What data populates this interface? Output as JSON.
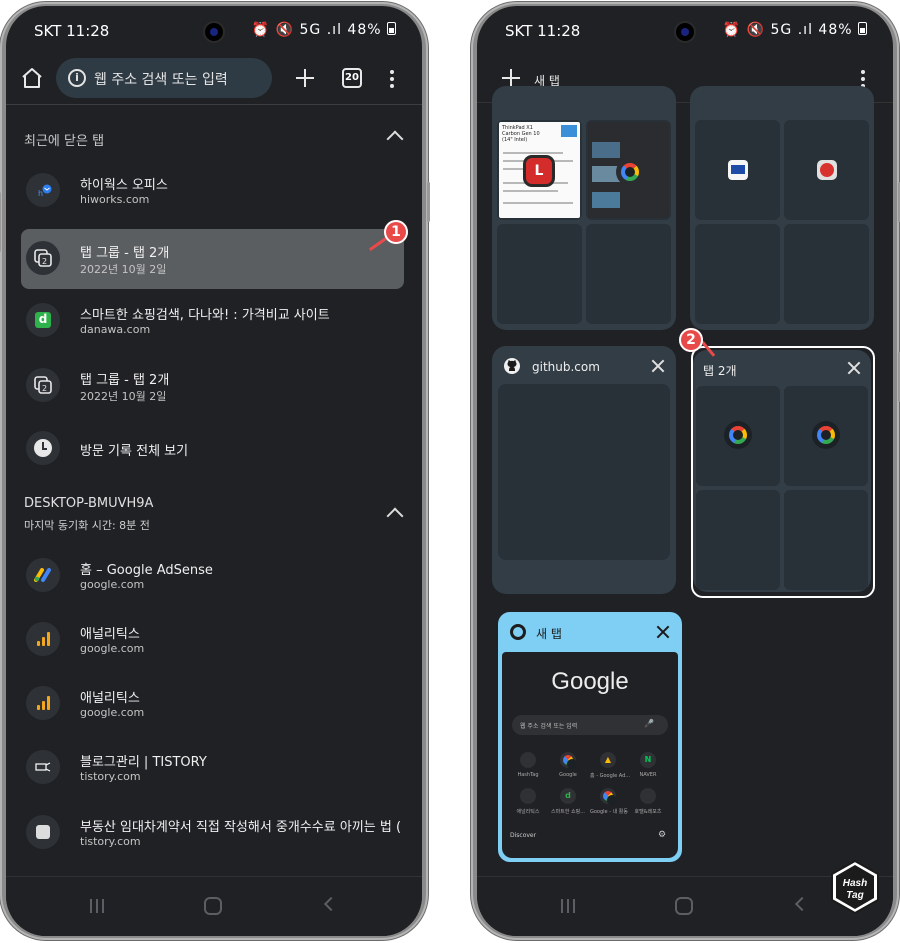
{
  "left": {
    "status": {
      "time": "SKT 11:28",
      "icons": "⏰ 🔇 5G .ıl",
      "battery": "48%"
    },
    "toolbar": {
      "search_placeholder": "웹 주소 검색 또는 입력",
      "tab_count": "20"
    },
    "recent_header": "최근에 닫은 탭",
    "recent": [
      {
        "title": "하이웍스 오피스",
        "sub": "hiworks.com",
        "icon": "hiworks-icon"
      },
      {
        "title": "탭 그룹 - 탭 2개",
        "sub": "2022년 10월 2일",
        "icon": "tab-group-icon"
      },
      {
        "title": "스마트한 쇼핑검색, 다나와! : 가격비교 사이트",
        "sub": "danawa.com",
        "icon": "danawa-icon",
        "favicon_text": "d"
      },
      {
        "title": "탭 그룹 - 탭 2개",
        "sub": "2022년 10월 2일",
        "icon": "tab-group-icon"
      },
      {
        "title": "방문 기록 전체 보기",
        "sub": "",
        "icon": "history-clock-icon"
      }
    ],
    "device_header": "DESKTOP-BMUVH9A",
    "device_sub": "마지막 동기화 시간: 8분 전",
    "device_items": [
      {
        "title": "홈 – Google AdSense",
        "sub": "google.com",
        "icon": "adsense-icon"
      },
      {
        "title": "애널리틱스",
        "sub": "google.com",
        "icon": "analytics-icon"
      },
      {
        "title": "애널리틱스",
        "sub": "google.com",
        "icon": "analytics-icon"
      },
      {
        "title": "블로그관리 | TISTORY",
        "sub": "tistory.com",
        "icon": "tistory-icon"
      },
      {
        "title": "부동산 임대차계약서 직접 작성해서 중개수수료 아끼는 법 (계...",
        "sub": "tistory.com",
        "icon": "tistory-page-icon"
      }
    ],
    "annotation_badge": "1"
  },
  "right": {
    "status": {
      "time": "SKT 11:28",
      "icons": "⏰ 🔇 5G .ıl",
      "battery": "48%"
    },
    "toolbar": {
      "new_tab_label": "새 탭"
    },
    "cards": {
      "github": {
        "title": "github.com"
      },
      "group": {
        "title": "탭 2개"
      },
      "newtab": {
        "title": "새 탭",
        "google_word": "Google",
        "search_placeholder": "웹 주소 검색 또는 입력",
        "discover": "Discover",
        "shortcuts": [
          "HashTag",
          "Google",
          "홈 - Google Ad...",
          "NAVER",
          "애널리틱스",
          "스마트한 쇼핑...",
          "Google - 내 활동",
          "호텔&레포츠"
        ],
        "shortcut_icons": [
          "",
          "G",
          "▲",
          "N",
          "",
          "d",
          "G",
          ""
        ]
      },
      "shopping_thumb": {
        "line1": "ThinkPad X1",
        "line2": "Carbon Gen 10",
        "line3": "(14\" Intel)",
        "badge": "L"
      }
    },
    "annotation_badge": "2",
    "watermark": "Hash Tag"
  }
}
